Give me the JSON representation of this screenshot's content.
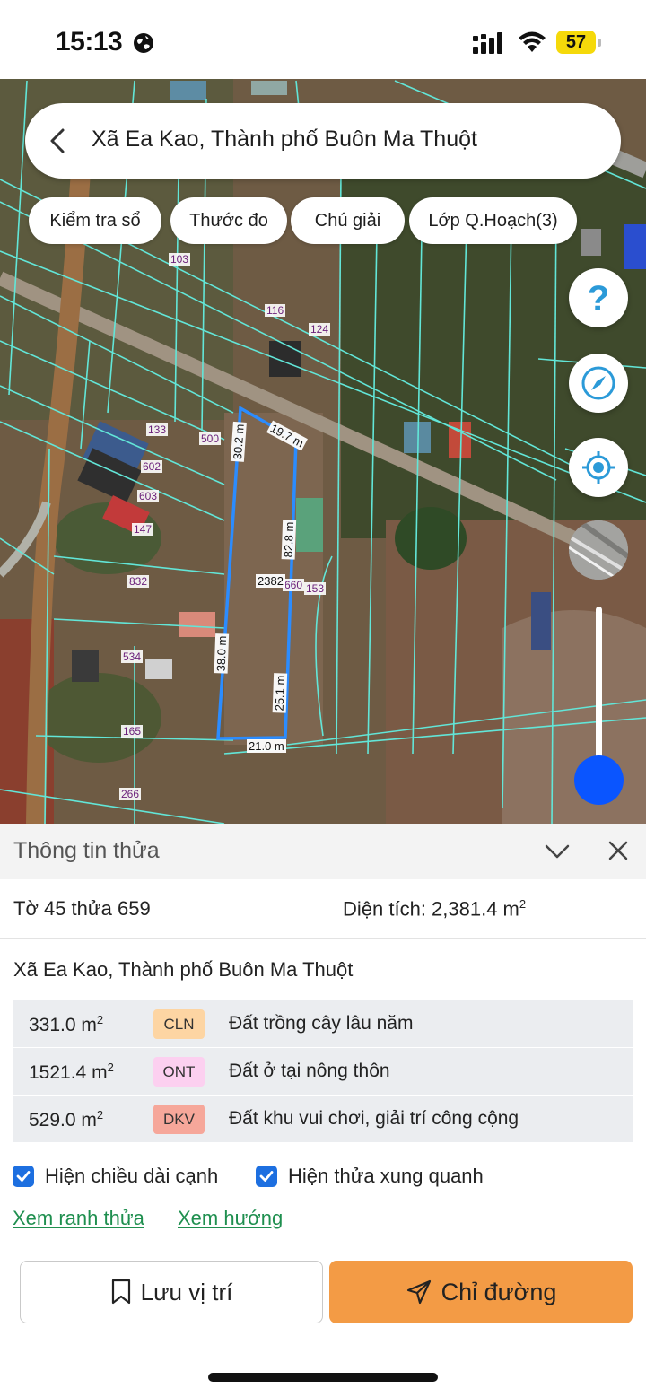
{
  "status_bar": {
    "time": "15:13",
    "battery": "57",
    "icons": [
      "globe-icon",
      "signal-icon",
      "wifi-icon",
      "battery-icon"
    ]
  },
  "search": {
    "title": "Xã Ea Kao, Thành phố Buôn Ma Thuột",
    "back_icon": "chevron-left-icon"
  },
  "chips": [
    {
      "label": "Kiểm tra sổ"
    },
    {
      "label": "Thước đo"
    },
    {
      "label": "Chú giải"
    },
    {
      "label": "Lớp Q.Hoạch(3)"
    }
  ],
  "map_controls": {
    "help_icon": "question-mark-icon",
    "compass_icon": "compass-icon",
    "locate_icon": "locate-icon",
    "layer_icon": "satellite-layer-icon",
    "zoom_level": 0.12
  },
  "map": {
    "plot_labels": [
      "103",
      "116",
      "124",
      "133",
      "500",
      "602",
      "603",
      "147",
      "832",
      "534",
      "165",
      "266",
      "660",
      "153"
    ],
    "edge_labels": [
      "30.2 m",
      "19.7 m",
      "82.8 m",
      "2382",
      "38.0 m",
      "25.1 m",
      "21.0 m"
    ]
  },
  "info_panel": {
    "title": "Thông tin thửa",
    "parcel_id": "Tờ 45 thửa 659",
    "area_label": "Diện tích: 2,381.4 m",
    "area_unit_sup": "2",
    "address": "Xã Ea Kao, Thành phố Buôn Ma Thuột",
    "land_uses": [
      {
        "area": "331.0 m",
        "sup": "2",
        "code": "CLN",
        "code_color": "#fdd5a3",
        "desc": "Đất trồng cây lâu năm"
      },
      {
        "area": "1521.4 m",
        "sup": "2",
        "code": "ONT",
        "code_color": "#fcd0f0",
        "desc": "Đất ở tại nông thôn"
      },
      {
        "area": "529.0 m",
        "sup": "2",
        "code": "DKV",
        "code_color": "#f6a79a",
        "desc": "Đất khu vui chơi, giải trí công cộng"
      }
    ],
    "checkboxes": [
      {
        "label": "Hiện chiều dài cạnh",
        "checked": true
      },
      {
        "label": "Hiện thửa xung quanh",
        "checked": true
      }
    ],
    "links": [
      "Xem ranh thửa",
      "Xem hướng"
    ],
    "buttons": {
      "save": "Lưu vị trí",
      "direction": "Chỉ đường"
    }
  },
  "colors": {
    "accent_orange": "#f39b45",
    "checkbox_blue": "#1d6fe0",
    "link_green": "#1f8f4f",
    "parcel_outline": "#2b8cff",
    "boundary_cyan": "#62e6d8",
    "zoom_blue": "#0a55ff"
  }
}
